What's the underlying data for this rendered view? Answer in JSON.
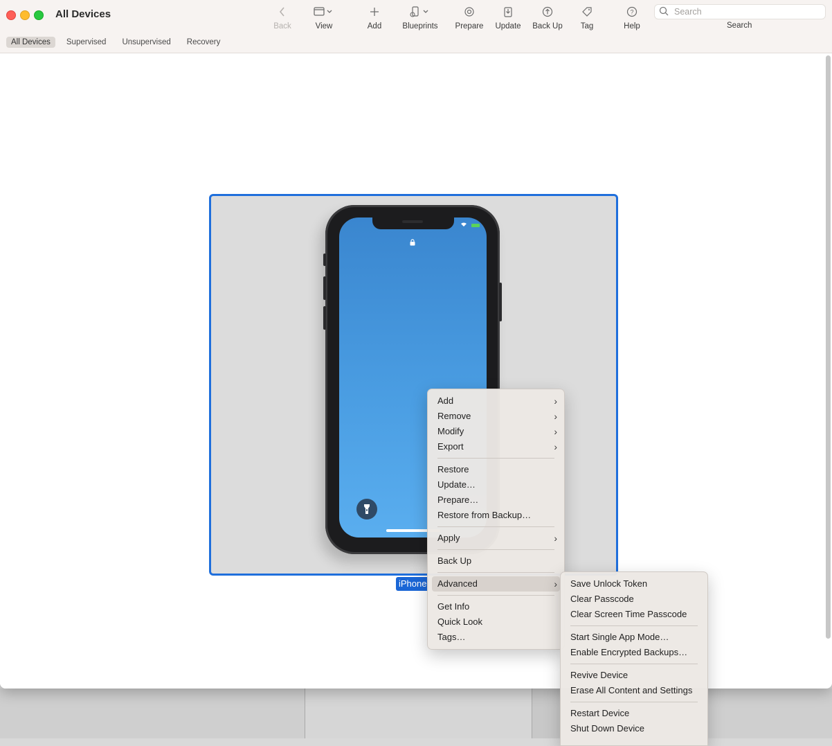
{
  "window": {
    "title": "All Devices"
  },
  "toolbar": {
    "back": "Back",
    "view": "View",
    "add": "Add",
    "blueprints": "Blueprints",
    "prepare": "Prepare",
    "update": "Update",
    "backup": "Back Up",
    "tag": "Tag",
    "help": "Help",
    "search_placeholder": "Search",
    "search_label": "Search"
  },
  "tabs": [
    {
      "label": "All Devices",
      "active": true
    },
    {
      "label": "Supervised"
    },
    {
      "label": "Unsupervised"
    },
    {
      "label": "Recovery"
    }
  ],
  "device": {
    "label": "iPhone"
  },
  "context_menu": {
    "items": [
      {
        "label": "Add",
        "submenu": true
      },
      {
        "label": "Remove",
        "submenu": true
      },
      {
        "label": "Modify",
        "submenu": true
      },
      {
        "label": "Export",
        "submenu": true
      },
      {
        "label": "Restore"
      },
      {
        "label": "Update…"
      },
      {
        "label": "Prepare…"
      },
      {
        "label": "Restore from Backup…"
      },
      {
        "label": "Apply",
        "submenu": true
      },
      {
        "label": "Back Up"
      },
      {
        "label": "Advanced",
        "submenu": true,
        "highlighted": true
      },
      {
        "label": "Get Info"
      },
      {
        "label": "Quick Look"
      },
      {
        "label": "Tags…"
      }
    ]
  },
  "advanced_submenu": {
    "items": [
      {
        "label": "Save Unlock Token"
      },
      {
        "label": "Clear Passcode"
      },
      {
        "label": "Clear Screen Time Passcode"
      },
      {
        "label": "Start Single App Mode…"
      },
      {
        "label": "Enable Encrypted Backups…"
      },
      {
        "label": "Revive Device"
      },
      {
        "label": "Erase All Content and Settings"
      },
      {
        "label": "Restart Device"
      },
      {
        "label": "Shut Down Device"
      }
    ]
  },
  "colors": {
    "accent": "#1f6fdc",
    "toolbar_bg": "#f7f3f1",
    "selection_label": "#1a66d6"
  }
}
